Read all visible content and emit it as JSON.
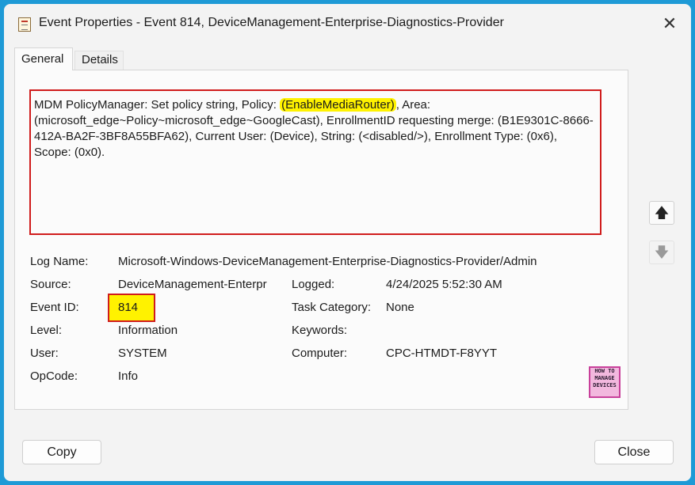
{
  "window": {
    "title": "Event Properties - Event 814, DeviceManagement-Enterprise-Diagnostics-Provider",
    "app_icon": "event-viewer-icon",
    "close_glyph": "✕"
  },
  "tabs": [
    {
      "label": "General",
      "active": true
    },
    {
      "label": "Details",
      "active": false
    }
  ],
  "message": {
    "before": "MDM PolicyManager: Set policy string, Policy: ",
    "highlight": "(EnableMediaRouter)",
    "after": ", Area: (microsoft_edge~Policy~microsoft_edge~GoogleCast), EnrollmentID requesting merge: (B1E9301C-8666-412A-BA2F-3BF8A55BFA62), Current User: (Device), String: (<disabled/>), Enrollment Type: (0x6), Scope: (0x0)."
  },
  "scroll": {
    "up_glyph": "🡅",
    "down_glyph": "🡇"
  },
  "fields": {
    "log_name": {
      "label": "Log Name:",
      "value": "Microsoft-Windows-DeviceManagement-Enterprise-Diagnostics-Provider/Admin"
    },
    "source": {
      "label": "Source:",
      "value": "DeviceManagement-Enterpr"
    },
    "logged": {
      "label": "Logged:",
      "value": "4/24/2025 5:52:30 AM"
    },
    "event_id": {
      "label": "Event ID:",
      "value": "814"
    },
    "task_category": {
      "label": "Task Category:",
      "value": "None"
    },
    "level": {
      "label": "Level:",
      "value": "Information"
    },
    "keywords": {
      "label": "Keywords:",
      "value": ""
    },
    "user": {
      "label": "User:",
      "value": "SYSTEM"
    },
    "computer": {
      "label": "Computer:",
      "value": "CPC-HTMDT-F8YYT"
    },
    "opcode": {
      "label": "OpCode:",
      "value": "Info"
    }
  },
  "logo": {
    "lines": [
      "HOW TO",
      "MANAGE",
      "DEVICES"
    ]
  },
  "buttons": {
    "copy": "Copy",
    "close": "Close"
  },
  "colors": {
    "highlight": "#fff200",
    "annotation_border": "#d01c1c",
    "backdrop": "#1e9ad6"
  }
}
